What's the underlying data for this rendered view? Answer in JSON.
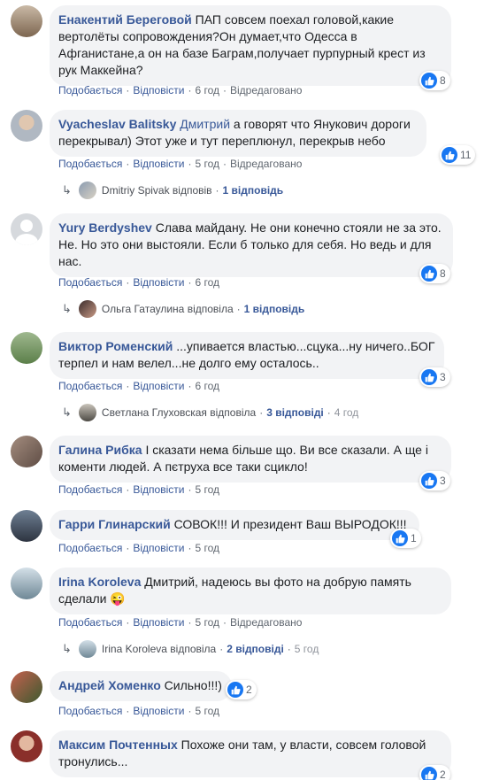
{
  "labels": {
    "like": "Подобається",
    "reply": "Відповісти",
    "edited": "Відредаговано"
  },
  "comments": [
    {
      "author": "Енакентий Береговой",
      "text": "ПАП совсем поехал головой,какие вертолёты сопровождения?Он думает,что Одесса в Афганистане,а он на базе Баграм,получает пурпурный крест из рук Маккейна?",
      "time": "6 год",
      "reactions": "8"
    },
    {
      "author": "Vyacheslav Balitsky",
      "mention": "Дмитрий",
      "text": "а говорят что Янукович дороги перекрывал) Этот уже и тут переплюнул, перекрыв небо",
      "time": "5 год",
      "reactions": "11",
      "replies": {
        "name": "Dmitriy Spivak відповів",
        "count": "1 відповідь"
      }
    },
    {
      "author": "Yury Berdyshev",
      "text": "Слава майдану. Не они конечно стояли не за это. Не. Но это они выстояли. Если б только для себя. Но ведь и для нас.",
      "time": "6 год",
      "reactions": "8",
      "replies": {
        "name": "Ольга Гатаулина відповіла",
        "count": "1 відповідь"
      }
    },
    {
      "author": "Виктор Роменский",
      "text": "...упивается властью...сцука...ну ничего..БОГ терпел и нам велел...не долго ему осталось..",
      "time": "6 год",
      "reactions": "3",
      "replies": {
        "name": "Светлана Глуховская відповіла",
        "count": "3 відповіді",
        "time": "4 год"
      }
    },
    {
      "author": "Галина Рибка",
      "text": "І сказати нема більше що. Ви все сказали. А ще і коменти людей. А пєтруха все таки сцикло!",
      "time": "5 год",
      "reactions": "3"
    },
    {
      "author": "Гарри Глинарский",
      "text": "СОВОК!!! И президент Ваш ВЫРОДОК!!!",
      "time": "5 год",
      "reactions": "1"
    },
    {
      "author": "Irina Koroleva",
      "text": "Дмитрий, надеюсь вы фото на добрую память сделали",
      "emoji": "😜",
      "time": "5 год",
      "replies": {
        "name": "Irina Koroleva відповіла",
        "count": "2 відповіді",
        "time": "5 год"
      }
    },
    {
      "author": "Андрей Хоменко",
      "text": "Сильно!!!)",
      "time": "5 год",
      "reactions": "2"
    },
    {
      "author": "Максим Почтенных",
      "text": "Похоже они там, у власти, совсем головой тронулись...",
      "reactions": "2"
    }
  ],
  "colors": {
    "link": "#385898",
    "bubble": "#f2f3f5",
    "like": "#1877f2",
    "meta": "#606770"
  },
  "icons": {
    "like": "thumbs-up-icon",
    "reply_arrow": "reply-arrow-icon"
  }
}
